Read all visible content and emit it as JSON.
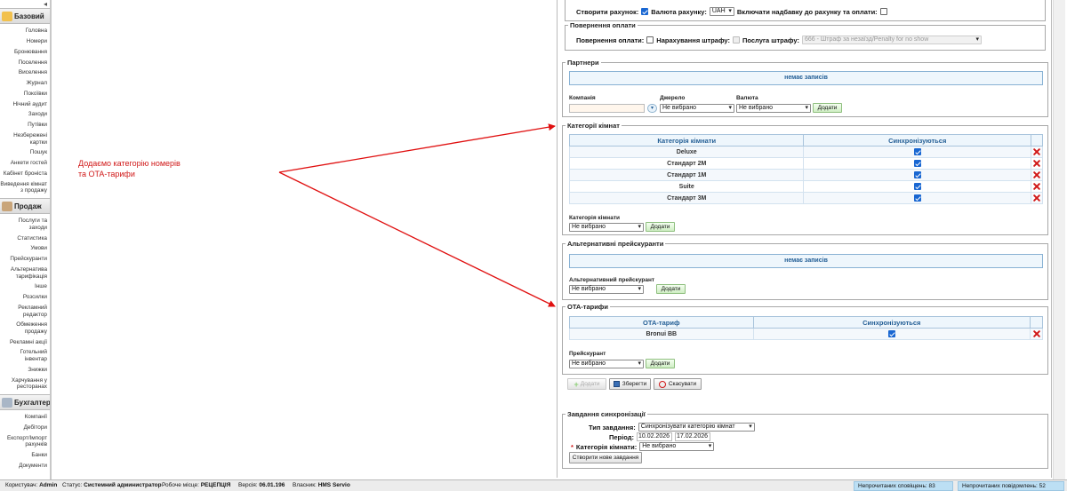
{
  "sidebar": {
    "collapse_label": "◂",
    "sections": [
      {
        "title": "Базовий",
        "color": "#f2c14e",
        "items": [
          "Головна",
          "Номери",
          "Бронювання",
          "Поселення",
          "Виселення",
          "Журнал",
          "Покоївки",
          "Нічний аудит",
          "Заходи",
          "Путівки",
          "Незбережені картки",
          "Пошук",
          "Анкети гостей",
          "Кабінет броніста",
          "Виведення кімнат з продажу"
        ]
      },
      {
        "title": "Продаж",
        "color": "#c9a57a",
        "items": [
          "Послуги та заходи",
          "Статистика",
          "Умови",
          "Прейскуранти",
          "Альтернатива тарифікація",
          "Інше",
          "Розсилки",
          "Рекламний редактор",
          "Обмеження продажу",
          "Рекламні акції",
          "Готельний інвентар",
          "Знижки",
          "Харчування у ресторанах"
        ]
      },
      {
        "title": "Бухгалтерія",
        "color": "#a9b6c6",
        "items": [
          "Компанії",
          "Дебітори",
          "Експорт/Імпорт рахунків",
          "Банки",
          "Документи"
        ]
      }
    ]
  },
  "annotation": {
    "text": "Додаємо категорію номерів\nта OTA-тарифи",
    "color": "#d01818"
  },
  "invoice": {
    "create_label": "Створити рахунок:",
    "create_checked": true,
    "currency_label": "Валюта рахунку:",
    "currency_value": "UAH",
    "include_label": "Включати надбавку до рахунку та оплати:",
    "include_checked": false
  },
  "refund": {
    "legend": "Повернення оплати",
    "refund_label": "Повернення оплати:",
    "penalty_label": "Нарахування штрафу:",
    "service_label": "Послуга штрафу:",
    "service_value": "666 - Штраф за незаїзд/Penalty for no show"
  },
  "partners": {
    "legend": "Партнери",
    "empty": "немає записів",
    "company_label": "Компанія",
    "source_label": "Джерело",
    "currency_label": "Валюта",
    "source_value": "Не вибрано",
    "currency_value": "Не вибрано",
    "add_label": "Додати"
  },
  "room_categories": {
    "legend": "Категорії кімнат",
    "col_category": "Категорія кімнати",
    "col_sync": "Синхронізуються",
    "rows": [
      {
        "name": "Deluxe",
        "sync": true
      },
      {
        "name": "Стандарт 2М",
        "sync": true
      },
      {
        "name": "Стандарт 1М",
        "sync": true
      },
      {
        "name": "Suite",
        "sync": true
      },
      {
        "name": "Стандарт 3М",
        "sync": true
      }
    ],
    "select_label": "Категорія кімнати",
    "select_value": "Не вибрано",
    "add_label": "Додати"
  },
  "alt_pricelists": {
    "legend": "Альтернативні прейскуранти",
    "empty": "немає записів",
    "select_label": "Альтернативний прейскурант",
    "select_value": "Не вибрано",
    "add_label": "Додати"
  },
  "ota_tariffs": {
    "legend": "OTA-тарифи",
    "col_tariff": "ОТА-тариф",
    "col_sync": "Синхронізуються",
    "rows": [
      {
        "name": "Bronui BB",
        "sync": true
      }
    ],
    "select_label": "Прейскурант",
    "select_value": "Не вибрано",
    "add_label": "Додати"
  },
  "actions": {
    "add": "Додати",
    "save": "Зберегти",
    "cancel": "Скасувати"
  },
  "sync_tasks": {
    "legend": "Завдання синхронізації",
    "type_label": "Тип завдання:",
    "type_value": "Синхронізувати категорію кімнат",
    "period_label": "Період:",
    "date_from": "10.02.2026",
    "date_to": "17.02.2026",
    "category_label": "Категорія кімнати:",
    "category_value": "Не вибрано",
    "create_label": "Створити нове завдання"
  },
  "statusbar": {
    "user_label": "Користувач:",
    "user": "Admin",
    "status_label": "Статус:",
    "status": "Системний администратор",
    "workplace_label": "Робоче місце:",
    "workplace": "РЕЦЕПЦІЯ",
    "version_label": "Версія:",
    "version": "06.01.196",
    "owner_label": "Власник:",
    "owner": "HMS Servio",
    "unread_alerts_label": "Непрочитаних сповіщень:",
    "unread_alerts": "83",
    "unread_messages_label": "Непрочитаних повідомлень:",
    "unread_messages": "52"
  }
}
